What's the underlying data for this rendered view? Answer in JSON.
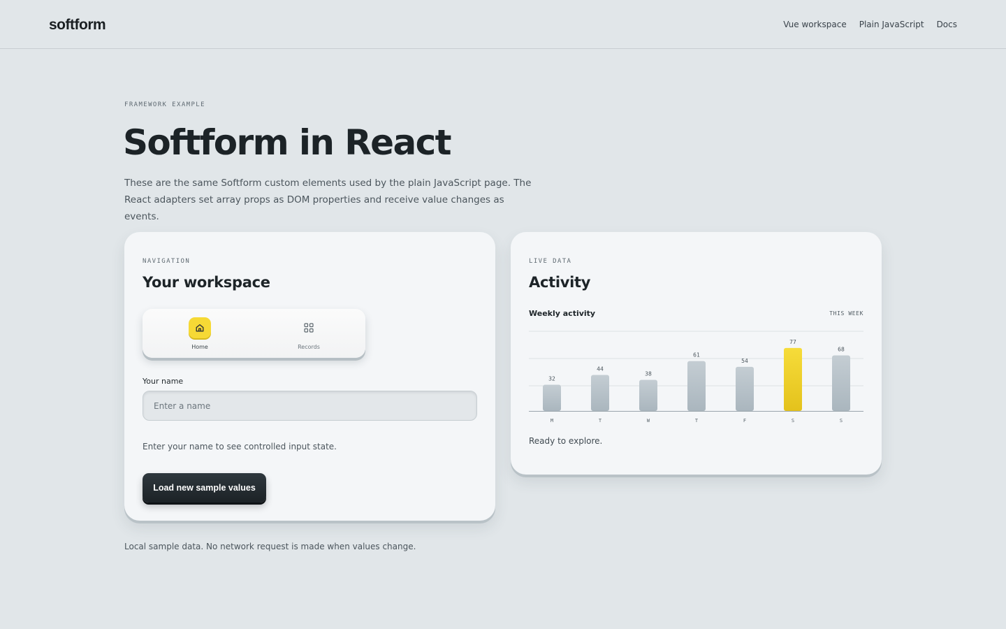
{
  "header": {
    "logo": "softform",
    "nav": [
      {
        "label": "Vue workspace"
      },
      {
        "label": "Plain JavaScript"
      },
      {
        "label": "Docs"
      }
    ]
  },
  "hero": {
    "eyebrow": "FRAMEWORK EXAMPLE",
    "title": "Softform in React",
    "description": "These are the same Softform custom elements used by the plain JavaScript page. The React adapters set array props as DOM properties and receive value changes as events."
  },
  "navigation_card": {
    "eyebrow": "NAVIGATION",
    "title": "Your workspace",
    "tabs": [
      {
        "label": "Home",
        "icon": "home-icon",
        "active": true
      },
      {
        "label": "Records",
        "icon": "grid-icon",
        "active": false
      }
    ],
    "name_field": {
      "label": "Your name",
      "placeholder": "Enter a name",
      "value": ""
    },
    "helper": "Enter your name to see controlled input state.",
    "button_label": "Load new sample values"
  },
  "activity_card": {
    "eyebrow": "LIVE DATA",
    "title": "Activity",
    "status": "Ready to explore."
  },
  "chart_data": {
    "type": "bar",
    "title": "Weekly activity",
    "period": "THIS WEEK",
    "categories": [
      "M",
      "T",
      "W",
      "T",
      "F",
      "S",
      "S"
    ],
    "values": [
      32,
      44,
      38,
      61,
      54,
      77,
      68
    ],
    "highlight_index": 5,
    "ylim": [
      0,
      100
    ],
    "grid": true,
    "colors": {
      "bar": "#b8c3ca",
      "highlight": "#f4d32e"
    }
  },
  "footer": {
    "note": "Local sample data. No network request is made when values change."
  },
  "colors": {
    "background": "#e1e6e9",
    "card": "#f4f6f8",
    "accent": "#f6d935",
    "primary_button": "#1f262a"
  }
}
